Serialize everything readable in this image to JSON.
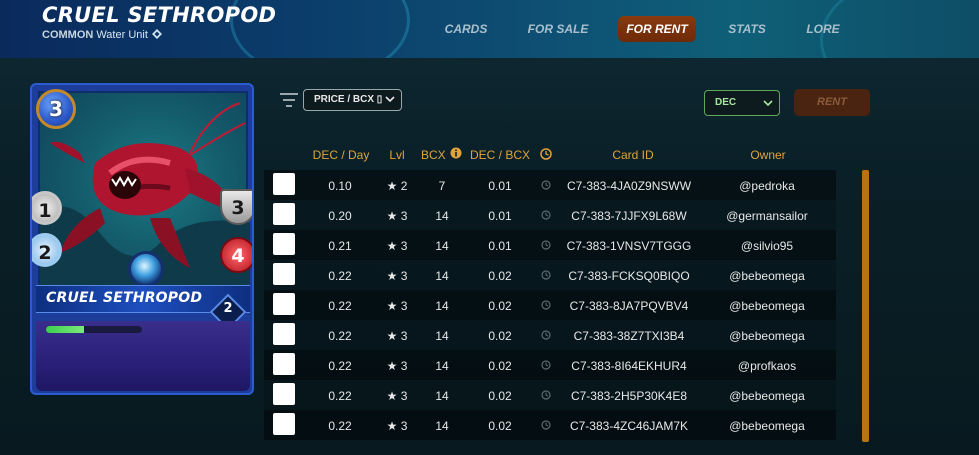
{
  "header": {
    "title": "CRUEL SETHROPOD",
    "rarity": "COMMON",
    "type": "Water Unit",
    "nav": [
      {
        "label": "CARDS",
        "active": false
      },
      {
        "label": "FOR SALE",
        "active": false
      },
      {
        "label": "FOR RENT",
        "active": true
      },
      {
        "label": "STATS",
        "active": false
      },
      {
        "label": "LORE",
        "active": false
      }
    ]
  },
  "card": {
    "name": "CRUEL SETHROPOD",
    "mana": "3",
    "melee": "1",
    "speed": "2",
    "armor": "3",
    "health": "4",
    "level": "2",
    "xp_fraction": 0.4,
    "element": "water"
  },
  "controls": {
    "sort_select": "PRICE / BCX ▯",
    "currency_select": "DEC",
    "rent_button": "RENT"
  },
  "table": {
    "headers": {
      "dec_per_day": "DEC / Day",
      "lvl": "Lvl",
      "bcx": "BCX",
      "dec_per_bcx": "DEC / BCX",
      "card_id": "Card ID",
      "owner": "Owner"
    },
    "rows": [
      {
        "dec_day": "0.10",
        "lvl": "★ 2",
        "bcx": "7",
        "dec_bcx": "0.01",
        "card_id": "C7-383-4JA0Z9NSWW",
        "owner": "@pedroka"
      },
      {
        "dec_day": "0.20",
        "lvl": "★ 3",
        "bcx": "14",
        "dec_bcx": "0.01",
        "card_id": "C7-383-7JJFX9L68W",
        "owner": "@germansailor"
      },
      {
        "dec_day": "0.21",
        "lvl": "★ 3",
        "bcx": "14",
        "dec_bcx": "0.01",
        "card_id": "C7-383-1VNSV7TGGG",
        "owner": "@silvio95"
      },
      {
        "dec_day": "0.22",
        "lvl": "★ 3",
        "bcx": "14",
        "dec_bcx": "0.02",
        "card_id": "C7-383-FCKSQ0BIQO",
        "owner": "@bebeomega"
      },
      {
        "dec_day": "0.22",
        "lvl": "★ 3",
        "bcx": "14",
        "dec_bcx": "0.02",
        "card_id": "C7-383-8JA7PQVBV4",
        "owner": "@bebeomega"
      },
      {
        "dec_day": "0.22",
        "lvl": "★ 3",
        "bcx": "14",
        "dec_bcx": "0.02",
        "card_id": "C7-383-38Z7TXI3B4",
        "owner": "@bebeomega"
      },
      {
        "dec_day": "0.22",
        "lvl": "★ 3",
        "bcx": "14",
        "dec_bcx": "0.02",
        "card_id": "C7-383-8I64EKHUR4",
        "owner": "@profkaos"
      },
      {
        "dec_day": "0.22",
        "lvl": "★ 3",
        "bcx": "14",
        "dec_bcx": "0.02",
        "card_id": "C7-383-2H5P30K4E8",
        "owner": "@bebeomega"
      },
      {
        "dec_day": "0.22",
        "lvl": "★ 3",
        "bcx": "14",
        "dec_bcx": "0.02",
        "card_id": "C7-383-4ZC46JAM7K",
        "owner": "@bebeomega"
      }
    ]
  },
  "colors": {
    "accent_header": "#e0a33a",
    "active_tab": "#8a3a0e",
    "currency_border": "#5fa85a"
  }
}
